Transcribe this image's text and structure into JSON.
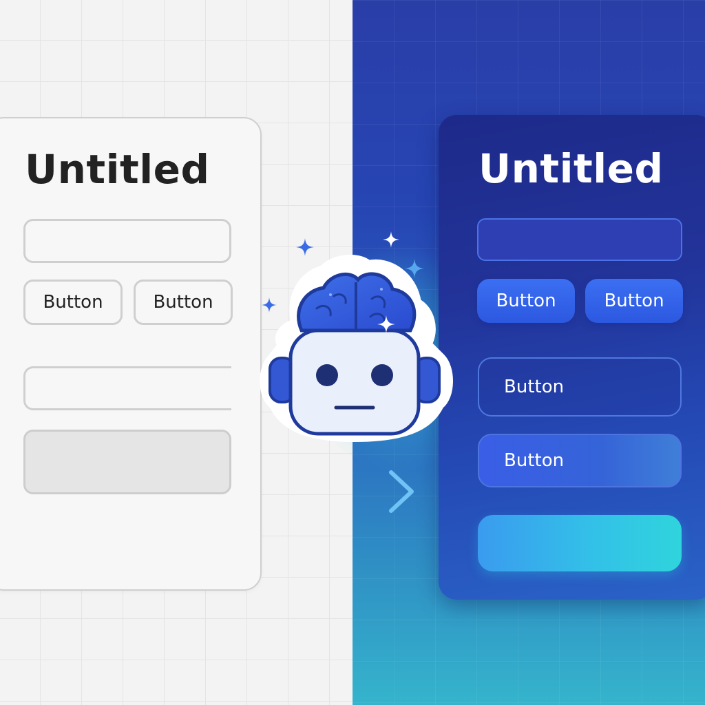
{
  "left_panel": {
    "title": "Untitled",
    "buttons": [
      "Button",
      "Button"
    ]
  },
  "right_panel": {
    "title": "Untitled",
    "buttons": [
      "Button",
      "Button"
    ],
    "outline_button": "Button",
    "soft_button": "Button"
  },
  "mascot": {
    "icon": "robot-brain-icon"
  },
  "colors": {
    "left_bg": "#f3f3f3",
    "right_bg_top": "#2a3ea8",
    "right_bg_bottom": "#35b4cc",
    "accent_blue": "#2c58e0",
    "accent_cyan": "#2fd4dc"
  }
}
